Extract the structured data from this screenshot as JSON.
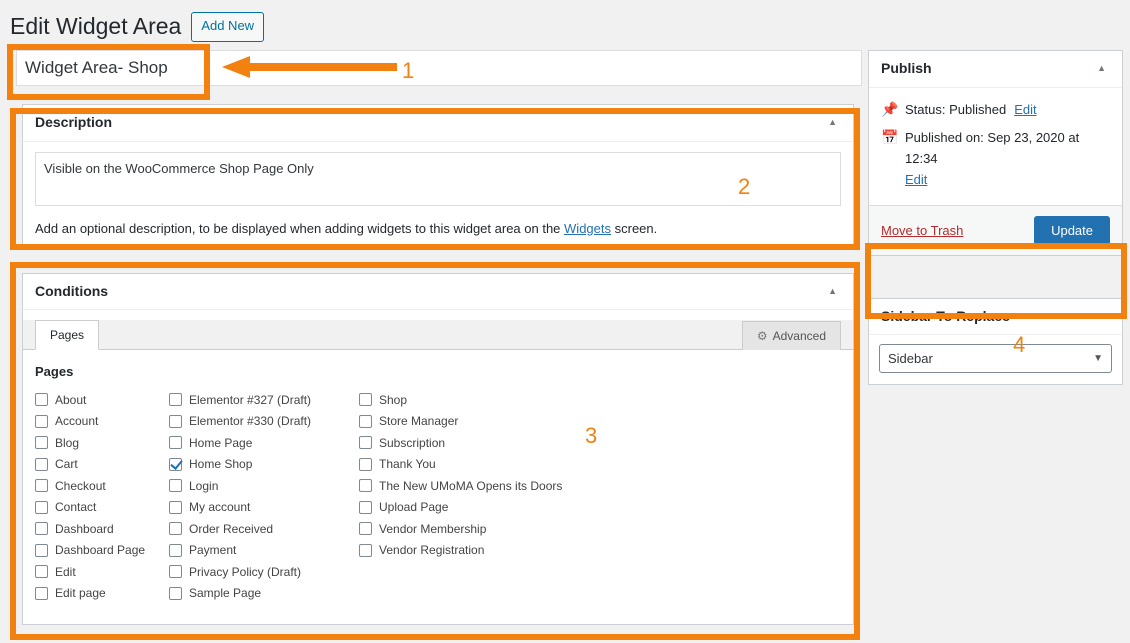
{
  "header": {
    "title": "Edit Widget Area",
    "add_new_label": "Add New"
  },
  "title_field": {
    "value": "Widget Area- Shop"
  },
  "description_panel": {
    "heading": "Description",
    "toggle_icon": "▲",
    "textarea_value": "Visible on the WooCommerce Shop Page Only",
    "help_prefix": "Add an optional description, to be displayed when adding widgets to this widget area on the ",
    "help_link": "Widgets",
    "help_suffix": " screen."
  },
  "conditions_panel": {
    "heading": "Conditions",
    "toggle_icon": "▲",
    "tabs": [
      {
        "label": "Pages",
        "active": true
      },
      {
        "label": "Advanced",
        "icon": "gear-icon",
        "active": false
      }
    ],
    "advanced_tab_label": "Advanced",
    "section_title": "Pages",
    "columns": [
      {
        "items": [
          {
            "label": "About",
            "checked": false
          },
          {
            "label": "Account",
            "checked": false
          },
          {
            "label": "Blog",
            "checked": false
          },
          {
            "label": "Cart",
            "checked": false
          },
          {
            "label": "Checkout",
            "checked": false
          },
          {
            "label": "Contact",
            "checked": false
          },
          {
            "label": "Dashboard",
            "checked": false
          },
          {
            "label": "Dashboard Page",
            "checked": false
          },
          {
            "label": "Edit",
            "checked": false
          },
          {
            "label": "Edit page",
            "checked": false
          }
        ]
      },
      {
        "items": [
          {
            "label": "Elementor #327 (Draft)",
            "checked": false
          },
          {
            "label": "Elementor #330 (Draft)",
            "checked": false
          },
          {
            "label": "Home Page",
            "checked": false
          },
          {
            "label": "Home Shop",
            "checked": true
          },
          {
            "label": "Login",
            "checked": false
          },
          {
            "label": "My account",
            "checked": false
          },
          {
            "label": "Order Received",
            "checked": false
          },
          {
            "label": "Payment",
            "checked": false
          },
          {
            "label": "Privacy Policy (Draft)",
            "checked": false
          },
          {
            "label": "Sample Page",
            "checked": false
          }
        ]
      },
      {
        "items": [
          {
            "label": "Shop",
            "checked": false
          },
          {
            "label": "Store Manager",
            "checked": false
          },
          {
            "label": "Subscription",
            "checked": false
          },
          {
            "label": "Thank You",
            "checked": false
          },
          {
            "label": "The New UMoMA Opens its Doors",
            "checked": false
          },
          {
            "label": "Upload Page",
            "checked": false
          },
          {
            "label": "Vendor Membership",
            "checked": false
          },
          {
            "label": "Vendor Registration",
            "checked": false
          }
        ]
      }
    ]
  },
  "publish_panel": {
    "heading": "Publish",
    "toggle_icon": "▲",
    "status_icon": "pin-icon",
    "status_text": "Status: Published",
    "status_edit_label": "Edit",
    "date_icon": "calendar-icon",
    "date_text": "Published on: Sep 23, 2020 at 12:34",
    "date_edit_label": "Edit",
    "trash_label": "Move to Trash",
    "update_label": "Update"
  },
  "sidebar_replace_panel": {
    "heading": "Sidebar To Replace",
    "toggle_icon": "▲",
    "selected_value": "Sidebar",
    "chevron_icon": "▼"
  },
  "annotations": {
    "one": "1",
    "two": "2",
    "three": "3",
    "four": "4",
    "accent_color": "#f28110"
  }
}
